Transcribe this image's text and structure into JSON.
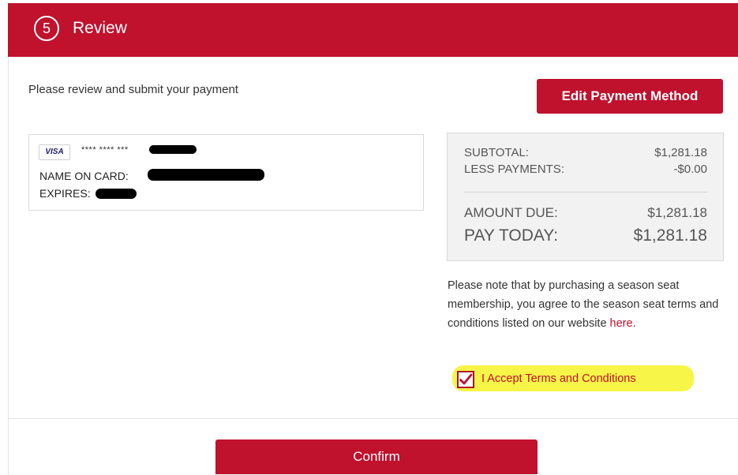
{
  "header": {
    "step_number": "5",
    "title": "Review"
  },
  "intro_text": "Please review and submit your payment",
  "edit_button_label": "Edit Payment Method",
  "card": {
    "brand": "VISA",
    "masked_number": "**** **** ***",
    "name_label": "NAME ON CARD:",
    "expires_label": "EXPIRES:"
  },
  "summary": {
    "subtotal_label": "SUBTOTAL:",
    "subtotal_value": "$1,281.18",
    "less_payments_label": "LESS PAYMENTS:",
    "less_payments_value": "-$0.00",
    "amount_due_label": "AMOUNT DUE:",
    "amount_due_value": "$1,281.18",
    "pay_today_label": "PAY TODAY:",
    "pay_today_value": "$1,281.18"
  },
  "terms": {
    "note": "Please note that by purchasing a season seat membership, you agree to the season seat terms and conditions listed on our website ",
    "link_text": "here",
    "note_end": ".",
    "accept_label": "I Accept Terms and Conditions",
    "accepted": true
  },
  "confirm_button_label": "Confirm",
  "colors": {
    "brand_red": "#c0112d",
    "highlight_yellow": "#f7f547",
    "summary_bg": "#f2f2f2"
  }
}
